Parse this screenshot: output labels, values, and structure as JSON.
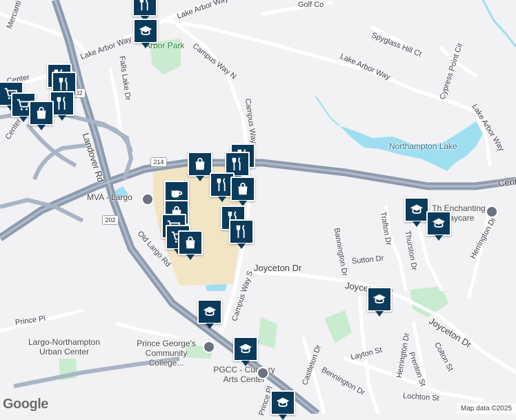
{
  "map": {
    "colors": {
      "land": "#f2f1f4",
      "road": "#ffffff",
      "highway": "#8e9bad",
      "park": "#c9ebcf",
      "water": "#9ddff0",
      "mall": "#f1e5c4"
    },
    "road_labels": [
      {
        "id": "lake-arbor-way-top",
        "text": "Lake Arbor Way"
      },
      {
        "id": "lake-arbor-way-nw",
        "text": "Lake Arbor Way"
      },
      {
        "id": "lake-arbor-way-center",
        "text": "Lake Arbor Way"
      },
      {
        "id": "lake-arbor-way-east",
        "text": "Lake Arbor Way"
      },
      {
        "id": "campus-way-n",
        "text": "Campus Way N"
      },
      {
        "id": "campus-way",
        "text": "Campus Way"
      },
      {
        "id": "campus-way-s",
        "text": "Campus Way S"
      },
      {
        "id": "landover-rd",
        "text": "Landover Rd"
      },
      {
        "id": "old-largo-rd",
        "text": "Old Largo Rd"
      },
      {
        "id": "falls-lake-dr",
        "text": "Falls Lake Dr"
      },
      {
        "id": "joyceton-dr-west",
        "text": "Joyceton Dr"
      },
      {
        "id": "joyceton-dr-mid",
        "text": "Joyceton Dr"
      },
      {
        "id": "joyceton-dr-east",
        "text": "Joyceton Dr"
      },
      {
        "id": "bannington-dr",
        "text": "Bannington Dr"
      },
      {
        "id": "trafton-dr",
        "text": "Trafton Dr"
      },
      {
        "id": "thurston-dr",
        "text": "Thurston Dr"
      },
      {
        "id": "sutton-dr",
        "text": "Sutton Dr"
      },
      {
        "id": "herrington-dr-east",
        "text": "Herrington Dr"
      },
      {
        "id": "herrington-dr-south",
        "text": "Herrington Dr"
      },
      {
        "id": "castleton-dr",
        "text": "Castleton Dr"
      },
      {
        "id": "bennington-dr",
        "text": "Bennington Dr"
      },
      {
        "id": "layton-st",
        "text": "Layton St"
      },
      {
        "id": "prenton-st",
        "text": "Prenton St"
      },
      {
        "id": "colton-st",
        "text": "Colton St"
      },
      {
        "id": "lochton-st",
        "text": "Lochton St"
      },
      {
        "id": "prince-pl",
        "text": "Prince Pl"
      },
      {
        "id": "prince-pl-south",
        "text": "Prince Pl"
      },
      {
        "id": "golf-course",
        "text": "Golf Co"
      },
      {
        "id": "spyglass-hill-ct",
        "text": "Spyglass Hill Ct"
      },
      {
        "id": "cypress-point-cir",
        "text": "Cypress Point Cir"
      },
      {
        "id": "mercantile",
        "text": "Mercanti"
      },
      {
        "id": "center-dr-left",
        "text": "Center Dr"
      },
      {
        "id": "center-dr-nw",
        "text": "Center"
      },
      {
        "id": "centre-east",
        "text": "Cent"
      }
    ],
    "place_labels": [
      {
        "id": "arbor-park",
        "text": "Arbor Park"
      },
      {
        "id": "mva-largo",
        "text": "MVA - Largo"
      },
      {
        "id": "northampton-lake",
        "text": "Northampton Lake"
      },
      {
        "id": "largo-northampton",
        "text": "Largo-Northampton Urban Center"
      },
      {
        "id": "prince-georges",
        "text": "Prince George's Community College..."
      },
      {
        "id": "pgcc-culinary",
        "text": "PGCC - Culinary Arts Center"
      },
      {
        "id": "enchanting",
        "text": "Th  Enchanting Daycare"
      }
    ],
    "route_shields": [
      {
        "id": "route-214",
        "text": "214"
      },
      {
        "id": "route-202",
        "text": "202"
      },
      {
        "id": "route-202-top",
        "text": "202"
      }
    ],
    "pins": {
      "school": "graduation-cap-icon",
      "restaurant": "fork-knife-icon",
      "shopping": "shopping-bag-icon",
      "grocery": "shopping-cart-icon",
      "cafe": "coffee-cup-icon"
    },
    "google_logo": "Google",
    "attribution": "Map data ©2025"
  }
}
